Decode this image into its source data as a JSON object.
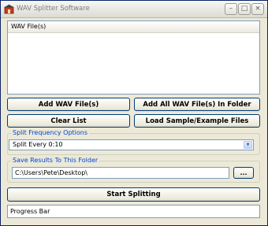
{
  "window": {
    "title": "WAV Splitter Software",
    "minimize_symbol": "–",
    "maximize_symbol": "□",
    "close_symbol": "×"
  },
  "file_list": {
    "column_header": "WAV File(s)",
    "items": []
  },
  "buttons": {
    "add_files": "Add WAV File(s)",
    "add_folder": "Add All WAV File(s) In Folder",
    "clear_list": "Clear List",
    "load_sample": "Load Sample/Example Files",
    "start": "Start Splitting"
  },
  "split_frequency": {
    "group_label": "Split Frequency Options",
    "selected": "Split Every 0:10"
  },
  "save_results": {
    "group_label": "Save Results To This Folder",
    "path": "C:\\Users\\Pete\\Desktop\\",
    "browse_label": "..."
  },
  "progress": {
    "label": "Progress Bar"
  }
}
